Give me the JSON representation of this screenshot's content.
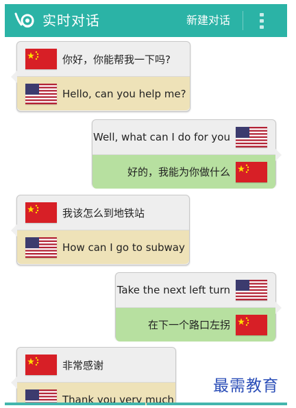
{
  "header": {
    "title": "实时对话",
    "new_chat_label": "新建对话",
    "menu_icon": "overflow-menu-icon"
  },
  "messages": [
    {
      "side": "left",
      "source_lang": "zh",
      "target_lang": "en",
      "source_text": "你好，你能帮我一下吗?",
      "translated_text": "Hello, can you help me?"
    },
    {
      "side": "right",
      "source_lang": "en",
      "target_lang": "zh",
      "source_text": "Well, what can I do for you",
      "translated_text": "好的，我能为你做什么"
    },
    {
      "side": "left",
      "source_lang": "zh",
      "target_lang": "en",
      "source_text": "我该怎么到地铁站",
      "translated_text": "How can I go to subway"
    },
    {
      "side": "right",
      "source_lang": "en",
      "target_lang": "zh",
      "source_text": "Take the next left turn",
      "translated_text": "在下一个路口左拐"
    },
    {
      "side": "left",
      "source_lang": "zh",
      "target_lang": "en",
      "source_text": "非常感谢",
      "translated_text": "Thank you very much"
    }
  ],
  "watermark": "最需教育",
  "colors": {
    "accent": "#2bb3a6",
    "left_translation_bg": "#eee2b8",
    "right_translation_bg": "#b7e0a0",
    "watermark": "#2c4fb8"
  }
}
